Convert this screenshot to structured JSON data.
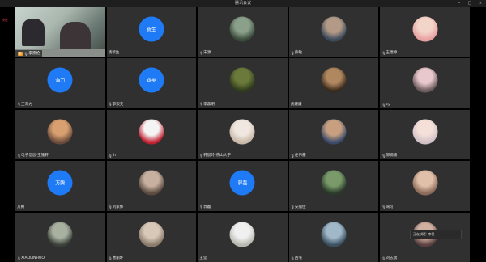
{
  "window": {
    "title": "腾讯会议",
    "controls": {
      "minimize": "–",
      "maximize": "□",
      "close": "×"
    }
  },
  "side_label": "按住",
  "active_speaker": {
    "name": "李凯伦",
    "badge": "主"
  },
  "tiles": [
    {
      "type": "video"
    },
    {
      "type": "initials",
      "initials": "新生",
      "name": "杨新生",
      "mic": false
    },
    {
      "type": "photo",
      "name": "宋源",
      "c1": "#8aa08a",
      "c2": "#3a4a3a",
      "mic": true
    },
    {
      "type": "photo",
      "name": "薛敏",
      "c1": "#b39a86",
      "c2": "#3b4a5c",
      "mic": true
    },
    {
      "type": "photo",
      "name": "王煜婷",
      "c1": "#f2d4c8",
      "c2": "#e8a0a0",
      "mic": true
    },
    {
      "type": "initials",
      "initials": "海力",
      "name": "王海力",
      "mic": true
    },
    {
      "type": "initials",
      "initials": "双英",
      "name": "李双英",
      "mic": true
    },
    {
      "type": "photo",
      "name": "李森明",
      "c1": "#6b7a3a",
      "c2": "#2f3a1c",
      "mic": true
    },
    {
      "type": "photo",
      "name": "武建康",
      "c1": "#b08860",
      "c2": "#3a2a1c",
      "mic": false
    },
    {
      "type": "photo",
      "name": "cy",
      "c1": "#e8c8cc",
      "c2": "#6a5a5c",
      "mic": true
    },
    {
      "type": "photo",
      "name": "电子信息-王施轩",
      "c1": "#d8a070",
      "c2": "#6a4a3a",
      "mic": true
    },
    {
      "type": "photo",
      "name": "lh",
      "c1": "#f4f4f4",
      "c2": "#c02030",
      "mic": true
    },
    {
      "type": "photo",
      "name": "韩宸玲-燕山大学",
      "c1": "#f0e8e0",
      "c2": "#c8b8a8",
      "mic": true
    },
    {
      "type": "photo",
      "name": "任伟豪",
      "c1": "#c8a080",
      "c2": "#3a4a6a",
      "mic": true
    },
    {
      "type": "photo",
      "name": "郝楠楠",
      "c1": "#f4e0d8",
      "c2": "#d0c0c8",
      "mic": true
    },
    {
      "type": "initials",
      "initials": "万腾",
      "name": "万腾",
      "mic": false
    },
    {
      "type": "photo",
      "name": "刘家伟",
      "c1": "#c8b0a0",
      "c2": "#5a4a40",
      "mic": true
    },
    {
      "type": "initials",
      "initials": "郭磊",
      "name": "郭磊",
      "mic": true
    },
    {
      "type": "photo",
      "name": "安丽佳",
      "c1": "#7a9a6a",
      "c2": "#2a3a2a",
      "mic": true
    },
    {
      "type": "photo",
      "name": "阔可",
      "c1": "#e0c0a8",
      "c2": "#8a6a5a",
      "mic": true
    },
    {
      "type": "photo",
      "name": "XIAOLINHUO",
      "c1": "#a8b0a0",
      "c2": "#3a4038",
      "mic": true
    },
    {
      "type": "photo",
      "name": "曹丽环",
      "c1": "#d8c8b8",
      "c2": "#8a7a6a",
      "mic": true
    },
    {
      "type": "photo",
      "name": "王莹",
      "c1": "#f0f0f0",
      "c2": "#b8b8b0",
      "mic": false
    },
    {
      "type": "photo",
      "name": "西宅",
      "c1": "#a0b8c8",
      "c2": "#3a5060",
      "mic": true
    },
    {
      "type": "photo",
      "name": "刘志斌",
      "c1": "#d0b0a0",
      "c2": "#5a4040",
      "mic": true
    }
  ],
  "toast": {
    "text": "正在讲话: 李凯",
    "dots": "···"
  }
}
